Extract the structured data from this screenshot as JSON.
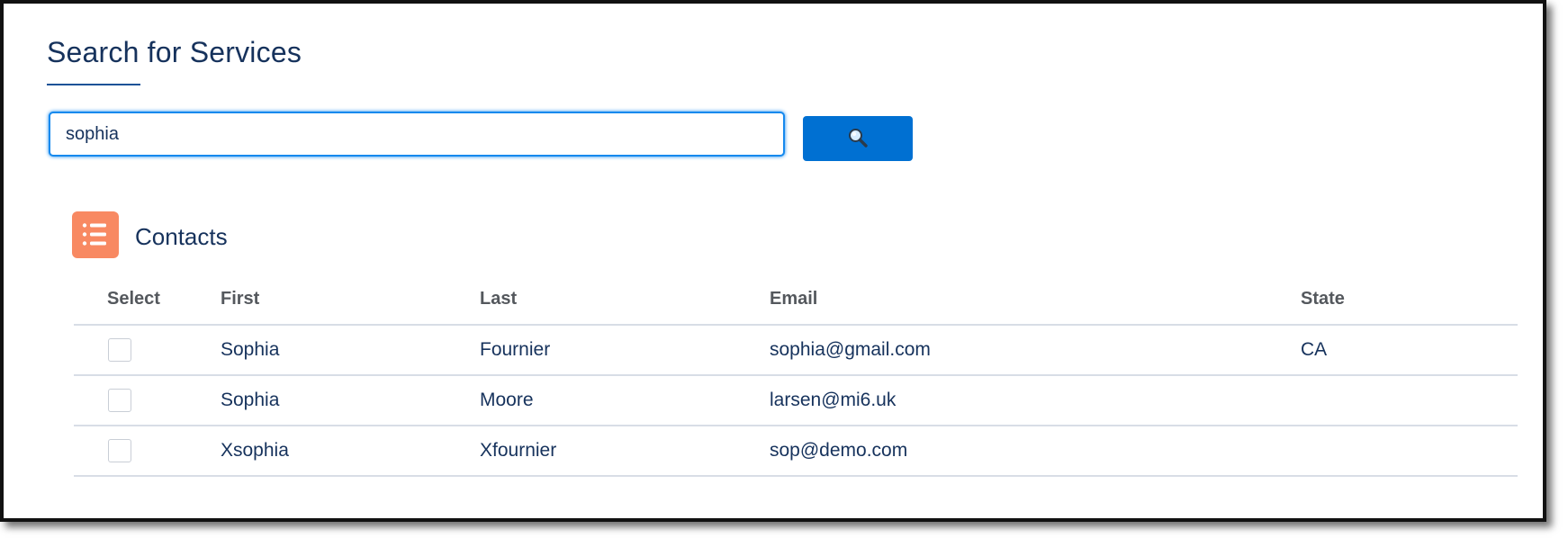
{
  "page": {
    "title": "Search for Services"
  },
  "search": {
    "value": "sophia",
    "button_icon": "search-icon"
  },
  "colors": {
    "accent": "#0070d2",
    "input_focus": "#1589ee",
    "title_text": "#16325c",
    "contacts_icon_bg": "#f88962"
  },
  "contacts": {
    "icon": "list-icon",
    "title": "Contacts",
    "columns": {
      "select": "Select",
      "first": "First",
      "last": "Last",
      "email": "Email",
      "state": "State"
    },
    "rows": [
      {
        "first": "Sophia",
        "last": "Fournier",
        "email": "sophia@gmail.com",
        "state": "CA",
        "selected": false
      },
      {
        "first": "Sophia",
        "last": "Moore",
        "email": "larsen@mi6.uk",
        "state": "",
        "selected": false
      },
      {
        "first": "Xsophia",
        "last": "Xfournier",
        "email": "sop@demo.com",
        "state": "",
        "selected": false
      }
    ]
  }
}
